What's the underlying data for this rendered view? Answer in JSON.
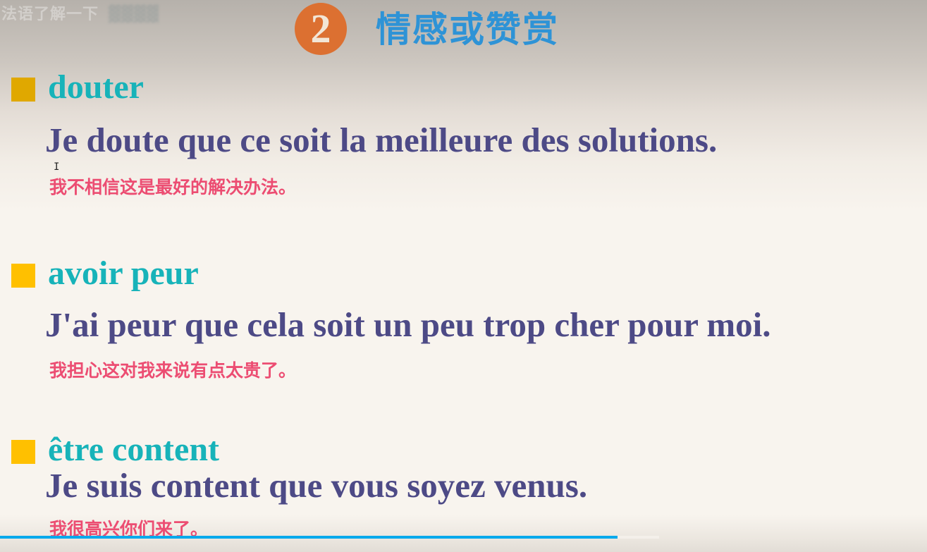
{
  "watermark": {
    "text": "法语了解一下",
    "blurred_text": "▓▓▓▓"
  },
  "slide": {
    "number": "2",
    "title": "情感或赞赏",
    "colors": {
      "badge": "#dc7031",
      "title": "#2e93d6",
      "heading": "#17b3b9",
      "french": "#4d4a86",
      "chinese": "#ec4d72",
      "bullet": "#ffc000"
    },
    "items": [
      {
        "heading": "douter",
        "french": "Je doute que ce soit la meilleure des solutions.",
        "chinese": "我不相信这是最好的解决办法。"
      },
      {
        "heading": "avoir peur",
        "french": "J'ai peur que cela soit un peu trop cher pour moi.",
        "chinese": "我担心这对我来说有点太贵了。"
      },
      {
        "heading": "être content",
        "french": "Je suis content que vous soyez venus.",
        "chinese": "我很高兴你们来了。"
      }
    ]
  },
  "player": {
    "progress_percent": 66.6,
    "buffered_percent": 71.1,
    "progress_color": "#00a9ec"
  }
}
